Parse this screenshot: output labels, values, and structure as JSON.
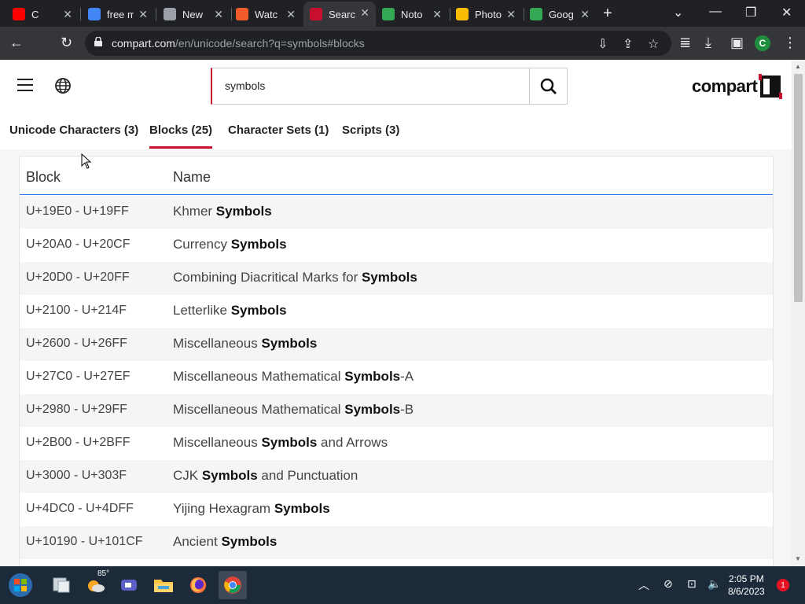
{
  "browser": {
    "tabs": [
      {
        "title": "C",
        "icon": "youtube-icon",
        "color": "#ff0000"
      },
      {
        "title": "free m",
        "icon": "google-icon",
        "color": "#4285f4"
      },
      {
        "title": "New",
        "icon": "chrome-icon",
        "color": "#9aa0a6"
      },
      {
        "title": "Watc",
        "icon": "tubi-icon",
        "color": "#f25c2a"
      },
      {
        "title": "Searc",
        "icon": "compart-icon",
        "color": "#c8102e"
      },
      {
        "title": "Noto",
        "icon": "noto-icon",
        "color": "#34a853"
      },
      {
        "title": "Photo",
        "icon": "photos-icon",
        "color": "#fbbc04"
      },
      {
        "title": "Goog",
        "icon": "maps-icon",
        "color": "#34a853"
      }
    ],
    "url_host": "compart.com",
    "url_path": "/en/unicode/search?q=symbols#blocks",
    "profile_initial": "C"
  },
  "header": {
    "search_value": "symbols",
    "logo_text": "compart"
  },
  "result_tabs": [
    {
      "label": "Unicode Characters (3)",
      "active": false
    },
    {
      "label": "Blocks (25)",
      "active": true
    },
    {
      "label": "Character Sets (1)",
      "active": false
    },
    {
      "label": "Scripts (3)",
      "active": false
    }
  ],
  "table": {
    "columns": [
      "Block",
      "Name"
    ],
    "rows": [
      {
        "range": "U+19E0 - U+19FF",
        "pre": "Khmer ",
        "match": "Symbols",
        "post": ""
      },
      {
        "range": "U+20A0 - U+20CF",
        "pre": "Currency ",
        "match": "Symbols",
        "post": ""
      },
      {
        "range": "U+20D0 - U+20FF",
        "pre": "Combining Diacritical Marks for ",
        "match": "Symbols",
        "post": ""
      },
      {
        "range": "U+2100 - U+214F",
        "pre": "Letterlike ",
        "match": "Symbols",
        "post": ""
      },
      {
        "range": "U+2600 - U+26FF",
        "pre": "Miscellaneous ",
        "match": "Symbols",
        "post": ""
      },
      {
        "range": "U+27C0 - U+27EF",
        "pre": "Miscellaneous Mathematical ",
        "match": "Symbols",
        "post": "-A"
      },
      {
        "range": "U+2980 - U+29FF",
        "pre": "Miscellaneous Mathematical ",
        "match": "Symbols",
        "post": "-B"
      },
      {
        "range": "U+2B00 - U+2BFF",
        "pre": "Miscellaneous ",
        "match": "Symbols",
        "post": " and Arrows"
      },
      {
        "range": "U+3000 - U+303F",
        "pre": "CJK ",
        "match": "Symbols",
        "post": " and Punctuation"
      },
      {
        "range": "U+4DC0 - U+4DFF",
        "pre": "Yijing Hexagram ",
        "match": "Symbols",
        "post": ""
      },
      {
        "range": "U+10190 - U+101CF",
        "pre": "Ancient ",
        "match": "Symbols",
        "post": ""
      }
    ]
  },
  "taskbar": {
    "weather_temp": "85°",
    "time": "2:05 PM",
    "date": "8/6/2023",
    "notification_count": "1"
  },
  "colors": {
    "accent": "#c8102e",
    "header_underline": "#1a73e8"
  }
}
